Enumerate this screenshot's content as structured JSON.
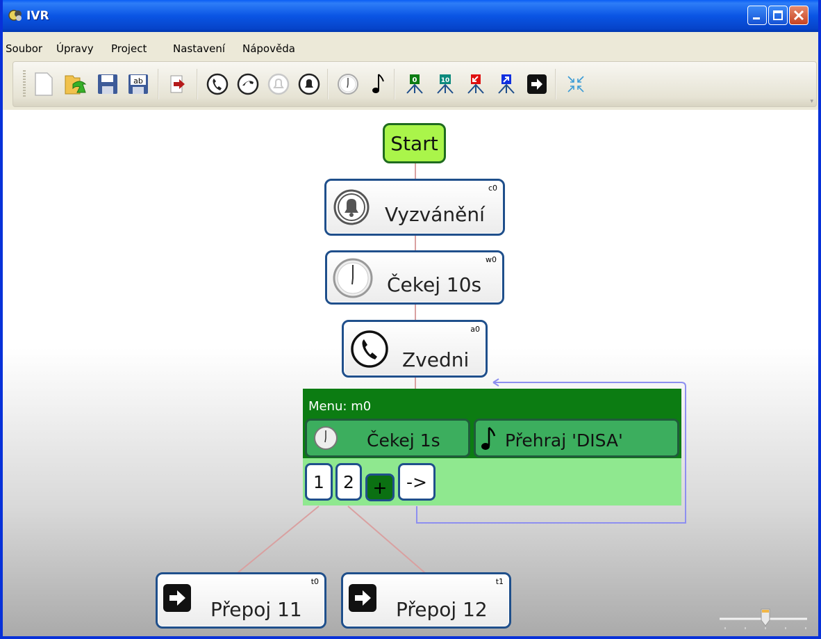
{
  "window": {
    "title": "IVR"
  },
  "menubar": {
    "items": [
      "Soubor",
      "Úpravy",
      "Project",
      "Nastavení",
      "Nápověda"
    ]
  },
  "toolbar": {
    "tools": [
      {
        "name": "new-document-icon"
      },
      {
        "name": "open-folder-icon"
      },
      {
        "name": "save-icon"
      },
      {
        "name": "save-as-icon",
        "text": "ab"
      },
      {
        "name": "exit-icon"
      },
      {
        "name": "phone-answer-icon"
      },
      {
        "name": "phone-hangup-icon"
      },
      {
        "name": "bell-disabled-icon"
      },
      {
        "name": "bell-icon"
      },
      {
        "name": "clock-icon"
      },
      {
        "name": "music-note-icon"
      },
      {
        "name": "menu-0-icon",
        "text": "0"
      },
      {
        "name": "menu-10-icon",
        "text": "10"
      },
      {
        "name": "menu-in-icon"
      },
      {
        "name": "menu-out-icon"
      },
      {
        "name": "transfer-icon"
      },
      {
        "name": "collapse-icon"
      }
    ]
  },
  "flow": {
    "start": "Start",
    "nodes": [
      {
        "id": "c0",
        "label": "Vyzvánění",
        "icon": "bell-icon"
      },
      {
        "id": "w0",
        "label": "Čekej 10s",
        "icon": "clock-icon"
      },
      {
        "id": "a0",
        "label": "Zvedni",
        "icon": "phone-answer-icon"
      }
    ],
    "menu": {
      "title": "Menu: m0",
      "items": [
        {
          "label": "Čekej 1s",
          "icon": "clock-icon"
        },
        {
          "label": "Přehraj 'DISA'",
          "icon": "music-note-icon"
        }
      ],
      "keys": [
        "1",
        "2",
        "+",
        "->"
      ]
    },
    "transfers": [
      {
        "id": "t0",
        "label": "Přepoj 11",
        "icon": "transfer-icon"
      },
      {
        "id": "t1",
        "label": "Přepoj 12",
        "icon": "transfer-icon"
      }
    ]
  },
  "zoom": {
    "level": 0.5
  },
  "colors": {
    "start_fill": "#aaf54a",
    "menu_header": "#0c7c12",
    "menu_body": "#8fe88f",
    "node_border": "#1f4f8b",
    "connector": "#d9a0a0",
    "loop": "#8d8ff0"
  }
}
